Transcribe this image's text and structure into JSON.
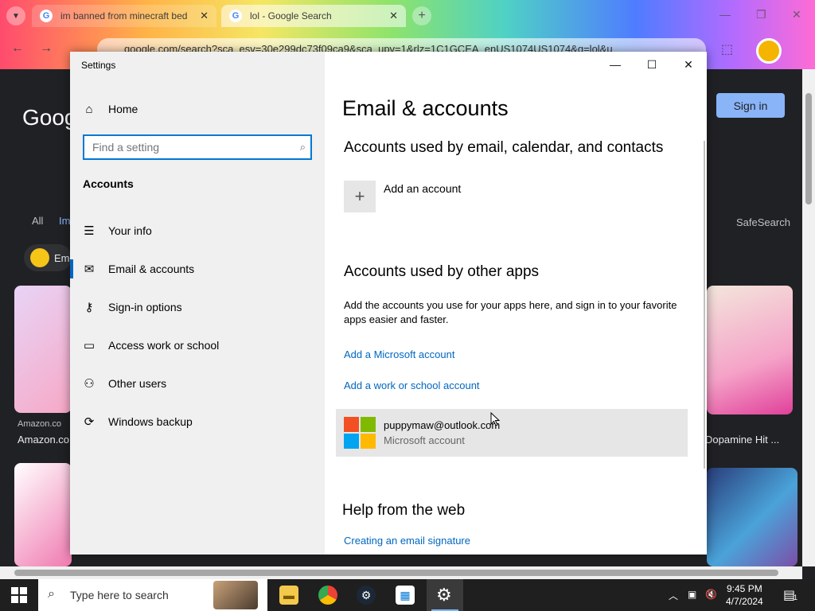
{
  "browser": {
    "tabs": [
      {
        "title": "im banned from minecraft bed"
      },
      {
        "title": "lol - Google Search"
      }
    ],
    "address": "google.com/search?sca_esv=30e299dc73f09ca9&sca_upv=1&rlz=1C1GCEA_enUS1074US1074&q=lol&u",
    "sign_in_label": "Sign in",
    "logo_text": "Goog",
    "tabs_row": [
      "All",
      "Im"
    ],
    "safesearch": "SafeSearch",
    "chip_label": "Em",
    "captions": [
      "Amazon.co",
      "Amazon.co",
      "Dopamine Hit ..."
    ]
  },
  "settings": {
    "app_title": "Settings",
    "home_label": "Home",
    "search_placeholder": "Find a setting",
    "section": "Accounts",
    "nav_items": [
      {
        "label": "Your info",
        "icon": "contact-card-icon"
      },
      {
        "label": "Email & accounts",
        "icon": "mail-icon"
      },
      {
        "label": "Sign-in options",
        "icon": "key-icon"
      },
      {
        "label": "Access work or school",
        "icon": "briefcase-icon"
      },
      {
        "label": "Other users",
        "icon": "person-icon"
      },
      {
        "label": "Windows backup",
        "icon": "sync-icon"
      }
    ],
    "selected_nav": "Email & accounts",
    "page_title": "Email & accounts",
    "h_email": "Accounts used by email, calendar, and contacts",
    "add_account": "Add an account",
    "h_other": "Accounts used by other apps",
    "other_desc": "Add the accounts you use for your apps here, and sign in to your favorite apps easier and faster.",
    "add_ms": "Add a Microsoft account",
    "add_work": "Add a work or school account",
    "account_email": "puppymaw@outlook.com",
    "account_type": "Microsoft account",
    "h_help": "Help from the web",
    "help_link": "Creating an email signature"
  },
  "taskbar": {
    "search_placeholder": "Type here to search",
    "time": "9:45 PM",
    "date": "4/7/2024",
    "notification_count": "1"
  },
  "colors": {
    "accent": "#0067c0",
    "ms_red": "#f25022",
    "ms_green": "#7fba00",
    "ms_blue": "#00a4ef",
    "ms_yellow": "#ffb900"
  }
}
